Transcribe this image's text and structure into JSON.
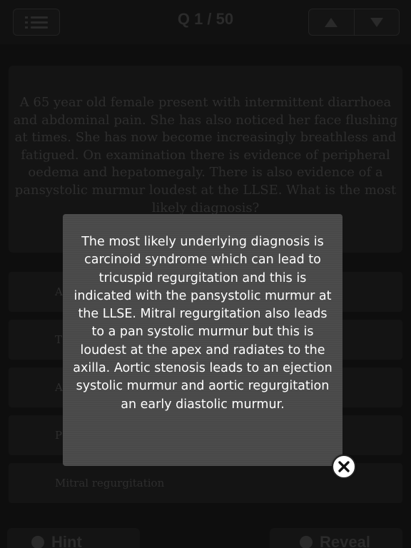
{
  "header": {
    "menu_icon": "list-icon",
    "counter": "Q 1 / 50",
    "prev_icon": "triangle-up-icon",
    "next_icon": "triangle-down-icon"
  },
  "question": {
    "text": "A 65 year old female present with intermittent diarrhoea and abdominal pain. She has also noticed her face flushing at times. She has now become increasingly breathless and fatigued. On examination there is evidence of peripheral oedema and hepatomegaly. There is also evidence of a pansystolic murmur loudest at the LLSE. What is the most likely diagnosis?"
  },
  "answers": [
    {
      "label": "A"
    },
    {
      "label": "T"
    },
    {
      "label": "A"
    },
    {
      "label": "P"
    },
    {
      "label": "Mitral regurgitation"
    }
  ],
  "bottom": {
    "hint_label": "Hint",
    "reveal_label": "Reveal"
  },
  "explanation": {
    "text": "The most likely underlying diagnosis is carcinoid syndrome which can lead to tricuspid regurgitation and this is indicated with the pansystolic murmur at the LLSE. Mitral regurgitation also leads to a pan systolic murmur but this is loudest at the apex and radiates to the axilla. Aortic stenosis leads to an ejection systolic murmur and aortic regurgitation an early diastolic murmur.",
    "close_icon": "close-icon"
  },
  "colors": {
    "modal_bg": "#494949",
    "background": "#101010"
  }
}
